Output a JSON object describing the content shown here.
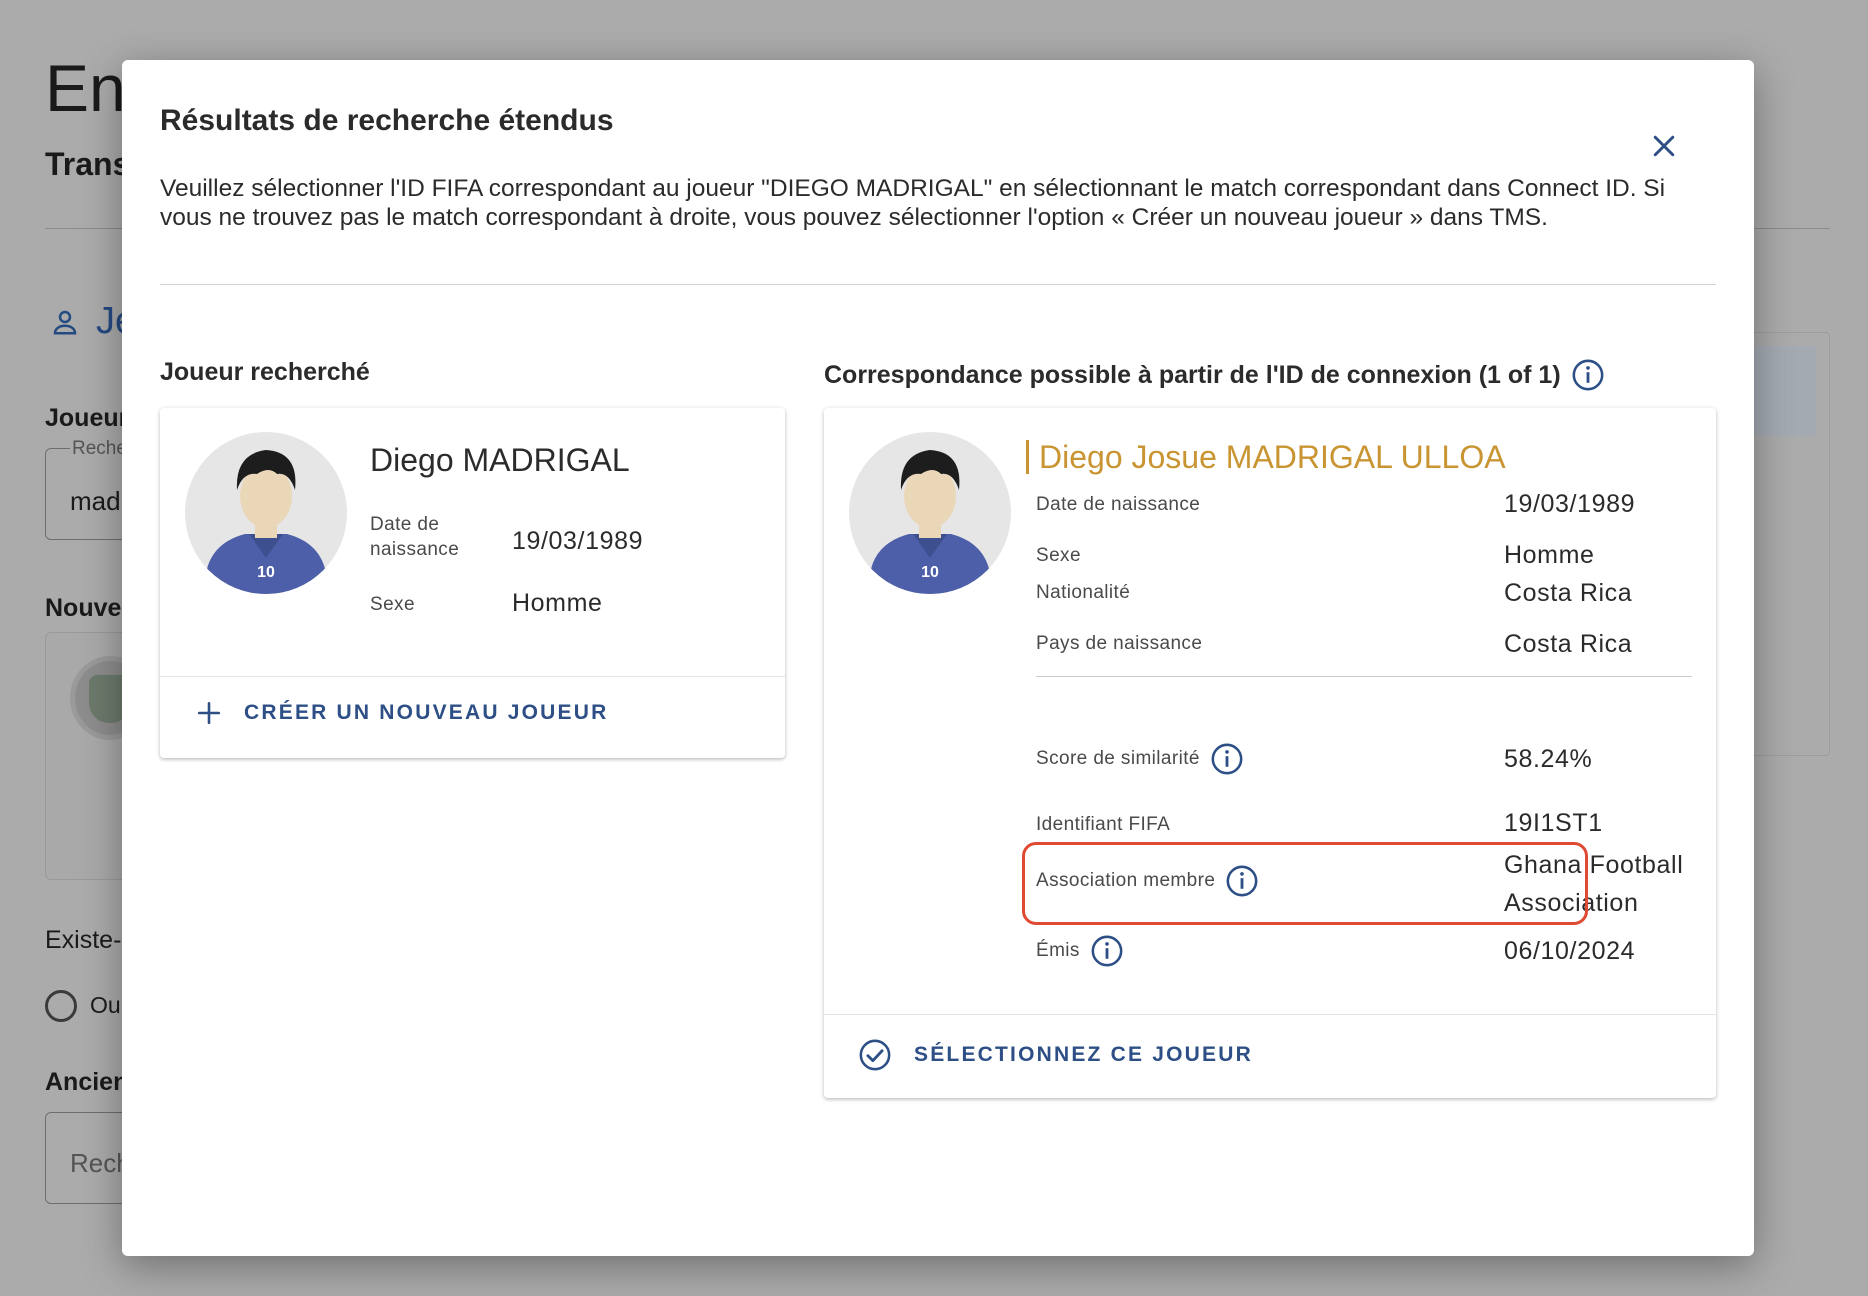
{
  "background": {
    "page_title": "Eng",
    "subtitle": "Trans",
    "section_title": "Je",
    "player_label": "Joueur",
    "search_field_label": "Reche",
    "search_field_value": "mad",
    "new_label": "Nouve",
    "exists_label": "Existe-",
    "radio_yes": "Oui",
    "former_label": "Ancien",
    "former_placeholder": "Rech"
  },
  "modal": {
    "title": "Résultats de recherche étendus",
    "description": "Veuillez sélectionner l'ID FIFA correspondant au joueur \"DIEGO MADRIGAL\" en sélectionnant le match correspondant dans Connect ID. Si vous ne trouvez pas le match correspondant à droite, vous pouvez sélectionner l'option « Créer un nouveau joueur » dans TMS.",
    "close_icon": "close-icon",
    "searched": {
      "column_title": "Joueur recherché",
      "name": "Diego MADRIGAL",
      "jersey_number": "10",
      "dob_label": "Date de naissance",
      "dob_value": "19/03/1989",
      "sex_label": "Sexe",
      "sex_value": "Homme",
      "create_button": "CRÉER UN NOUVEAU JOUEUR"
    },
    "match": {
      "column_title": "Correspondance possible à partir de l'ID de connexion (1 of 1)",
      "name": "Diego Josue MADRIGAL ULLOA",
      "jersey_number": "10",
      "dob_label": "Date de naissance",
      "dob_value": "19/03/1989",
      "sex_label": "Sexe",
      "sex_value": "Homme",
      "nationality_label": "Nationalité",
      "nationality_value": "Costa Rica",
      "birth_country_label": "Pays de naissance",
      "birth_country_value": "Costa Rica",
      "similarity_label": "Score de similarité",
      "similarity_value": "58.24%",
      "fifa_id_label": "Identifiant FIFA",
      "fifa_id_value": "19I1ST1",
      "association_label": "Association membre",
      "association_value_line1": "Ghana Football",
      "association_value_line2": "Association",
      "issued_label": "Émis",
      "issued_value": "06/10/2024",
      "select_button": "SÉLECTIONNEZ CE JOUEUR"
    }
  },
  "colors": {
    "primary": "#2d4f86",
    "match_name": "#c99532",
    "highlight": "#e04a33",
    "jersey": "#4c5fa8"
  }
}
